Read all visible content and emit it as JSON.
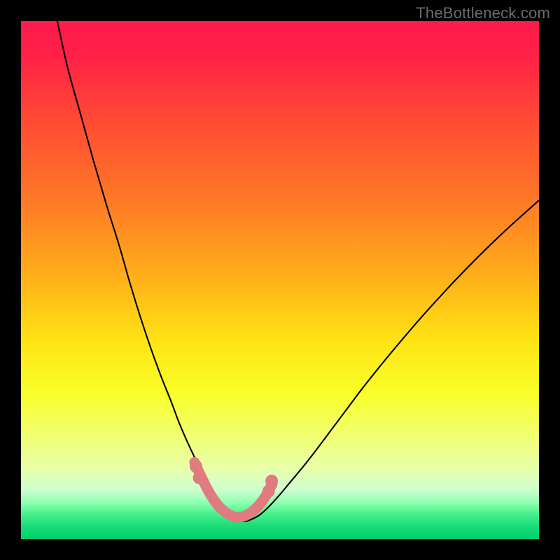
{
  "watermark": {
    "text": "TheBottleneck.com"
  },
  "chart_data": {
    "type": "line",
    "title": "",
    "xlabel": "",
    "ylabel": "",
    "xlim": [
      0,
      100
    ],
    "ylim": [
      0,
      100
    ],
    "grid": false,
    "legend": false,
    "background_gradient_stops": [
      {
        "offset": 0.0,
        "color": "#ff1b4b"
      },
      {
        "offset": 0.06,
        "color": "#ff1f47"
      },
      {
        "offset": 0.2,
        "color": "#ff4d33"
      },
      {
        "offset": 0.35,
        "color": "#ff7a26"
      },
      {
        "offset": 0.5,
        "color": "#ffb21a"
      },
      {
        "offset": 0.62,
        "color": "#ffe414"
      },
      {
        "offset": 0.72,
        "color": "#f9ff2a"
      },
      {
        "offset": 0.8,
        "color": "#f1ff70"
      },
      {
        "offset": 0.86,
        "color": "#e8ffa6"
      },
      {
        "offset": 0.905,
        "color": "#cfffd0"
      },
      {
        "offset": 0.93,
        "color": "#8effb0"
      },
      {
        "offset": 0.95,
        "color": "#4cf28e"
      },
      {
        "offset": 0.97,
        "color": "#22e07c"
      },
      {
        "offset": 0.985,
        "color": "#0cd872"
      },
      {
        "offset": 1.0,
        "color": "#04ce6c"
      }
    ],
    "series": [
      {
        "name": "bottleneck-curve",
        "stroke": "#000000",
        "stroke_width": 2.1,
        "x": [
          7.0,
          9.0,
          11.5,
          14.0,
          16.5,
          19.0,
          21.0,
          23.0,
          25.0,
          27.0,
          29.0,
          30.5,
          32.0,
          33.5,
          35.0,
          36.0,
          37.0,
          38.0,
          39.0,
          40.0,
          41.0,
          42.0,
          43.0,
          44.0,
          46.0,
          48.0,
          50.0,
          52.0,
          54.5,
          57.0,
          60.0,
          63.0,
          66.0,
          70.0,
          74.0,
          78.0,
          82.0,
          86.0,
          90.0,
          94.0,
          98.0,
          100.0
        ],
        "y": [
          100.0,
          91.0,
          82.0,
          73.0,
          64.5,
          56.5,
          49.5,
          43.0,
          37.0,
          31.5,
          26.5,
          22.5,
          19.0,
          15.8,
          13.0,
          11.0,
          9.2,
          7.6,
          6.2,
          5.0,
          4.2,
          3.6,
          3.4,
          3.6,
          4.6,
          6.4,
          8.6,
          11.0,
          14.0,
          17.2,
          21.2,
          25.2,
          29.2,
          34.2,
          39.0,
          43.6,
          48.0,
          52.2,
          56.2,
          60.0,
          63.6,
          65.4
        ]
      },
      {
        "name": "highlight-band",
        "stroke": "#e07b7f",
        "stroke_width": 15,
        "linecap": "round",
        "x": [
          33.5,
          34.8,
          36.0,
          37.2,
          38.5,
          40.0,
          41.5,
          43.0,
          44.5,
          46.0,
          47.3,
          48.5
        ],
        "y": [
          14.8,
          12.0,
          9.6,
          7.6,
          6.0,
          4.8,
          4.2,
          4.4,
          5.2,
          6.6,
          8.4,
          10.6
        ]
      },
      {
        "name": "marker-dots",
        "type": "scatter",
        "fill": "#e07b7f",
        "radius": 9,
        "x": [
          33.8,
          34.4,
          47.8,
          48.4
        ],
        "y": [
          14.0,
          11.8,
          9.2,
          11.2
        ]
      }
    ]
  }
}
